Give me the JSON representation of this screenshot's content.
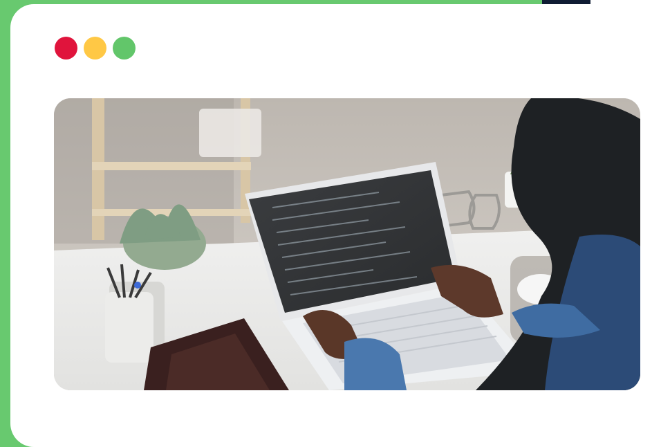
{
  "window": {
    "controls": [
      {
        "name": "close",
        "color": "#e0143c"
      },
      {
        "name": "minimize",
        "color": "#ffc845"
      },
      {
        "name": "maximize",
        "color": "#62c66a"
      }
    ]
  },
  "colors": {
    "background": "#68c96f",
    "card": "#ffffff",
    "dark_accent": "#0f1c33"
  },
  "photo": {
    "icon": "developer-at-laptop-image"
  }
}
